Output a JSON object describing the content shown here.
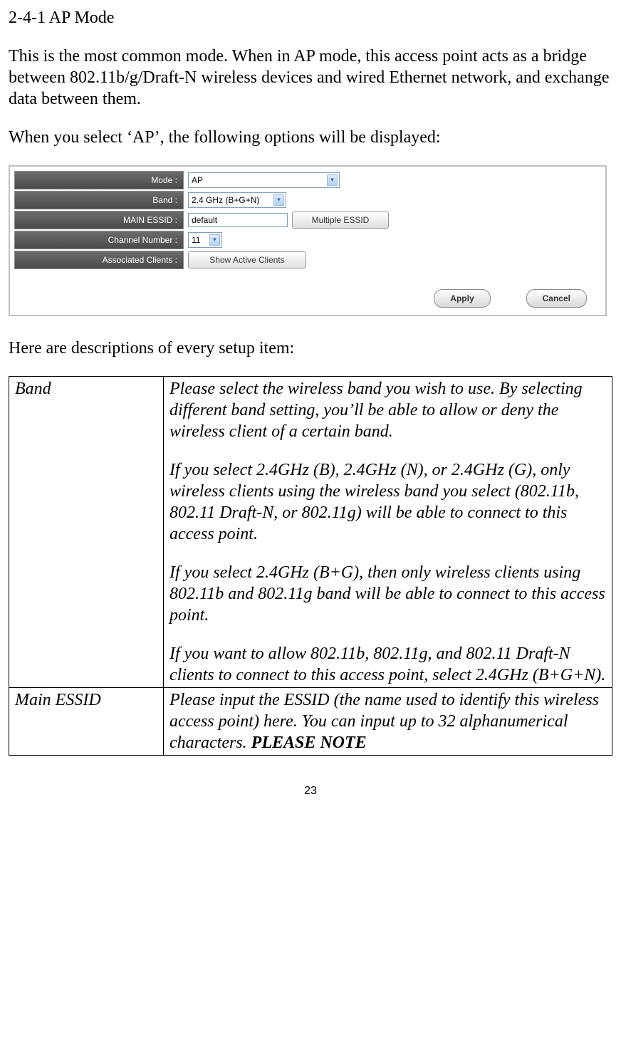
{
  "heading": "2-4-1 AP Mode",
  "intro_p1": "This is the most common mode. When in AP mode, this access point acts as a bridge between 802.11b/g/Draft-N wireless devices and wired Ethernet network, and exchange data between them.",
  "intro_p2": "When you select ‘AP’, the following options will be displayed:",
  "config": {
    "mode_label": "Mode :",
    "mode_value": "AP",
    "band_label": "Band :",
    "band_value": "2.4 GHz (B+G+N)",
    "essid_label": "MAIN ESSID :",
    "essid_value": "default",
    "multiple_essid_btn": "Multiple ESSID",
    "channel_label": "Channel Number :",
    "channel_value": "11",
    "assoc_label": "Associated Clients :",
    "show_clients_btn": "Show Active Clients",
    "apply_btn": "Apply",
    "cancel_btn": "Cancel"
  },
  "desc_intro": "Here are descriptions of every setup item:",
  "table": {
    "band_term": "Band",
    "band_p1": "Please select the wireless band you wish to use. By selecting different band setting, you’ll be able to allow or deny the wireless client of a certain band.",
    "band_p2": "If you select 2.4GHz (B), 2.4GHz (N), or 2.4GHz (G), only wireless clients using the wireless band you select (802.11b, 802.11 Draft-N, or 802.11g) will be able to connect to this access point.",
    "band_p3": "If you select 2.4GHz (B+G), then only wireless clients using 802.11b and 802.11g band will be able to connect to this access point.",
    "band_p4": "If you want to allow 802.11b, 802.11g, and 802.11 Draft-N clients to connect to this access point, select 2.4GHz (B+G+N).",
    "essid_term": "Main ESSID",
    "essid_p1a": "Please input the ESSID (the name used to identify this wireless access point) here. You can input up to 32 alphanumerical characters. ",
    "essid_p1b": "PLEASE NOTE"
  },
  "page_number": "23"
}
